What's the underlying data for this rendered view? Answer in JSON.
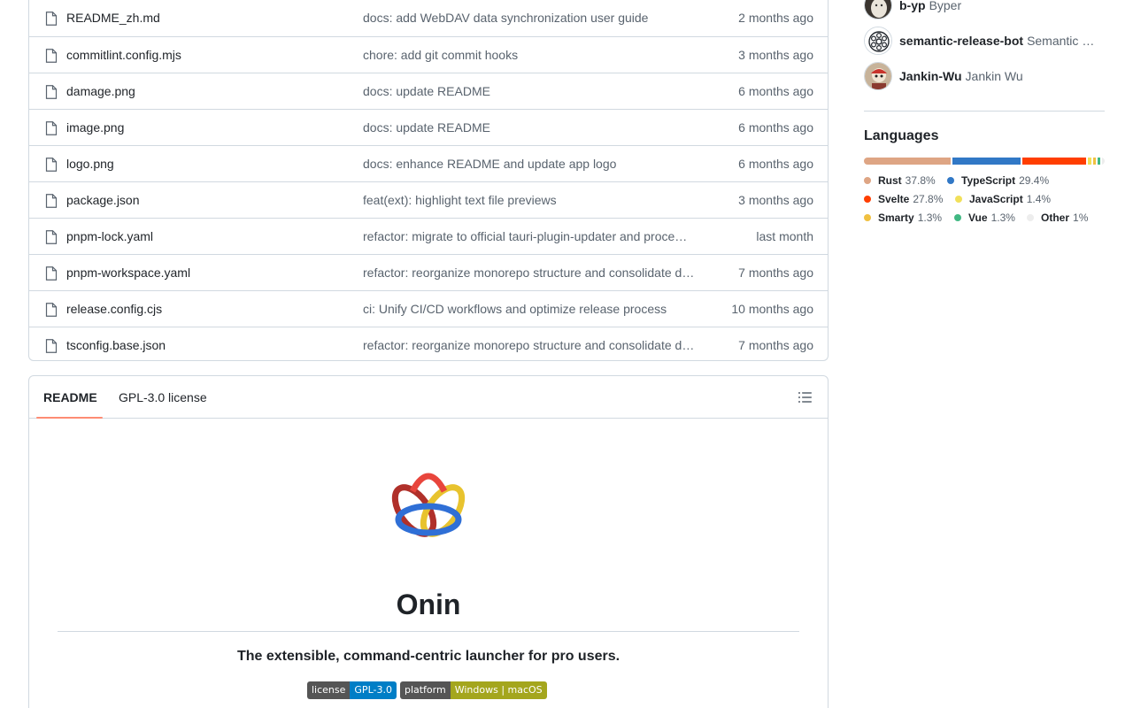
{
  "files": [
    {
      "name": "README_zh.md",
      "message": "docs: add WebDAV data synchronization user guide",
      "date": "2 months ago"
    },
    {
      "name": "commitlint.config.mjs",
      "message": "chore: add git commit hooks",
      "date": "3 months ago"
    },
    {
      "name": "damage.png",
      "message": "docs: update README",
      "date": "6 months ago"
    },
    {
      "name": "image.png",
      "message": "docs: update README",
      "date": "6 months ago"
    },
    {
      "name": "logo.png",
      "message": "docs: enhance README and update app logo",
      "date": "6 months ago"
    },
    {
      "name": "package.json",
      "message": "feat(ext): highlight text file previews",
      "date": "3 months ago"
    },
    {
      "name": "pnpm-lock.yaml",
      "message": "refactor: migrate to official tauri-plugin-updater and proce…",
      "date": "last month"
    },
    {
      "name": "pnpm-workspace.yaml",
      "message": "refactor: reorganize monorepo structure and consolidate d…",
      "date": "7 months ago"
    },
    {
      "name": "release.config.cjs",
      "message": "ci: Unify CI/CD workflows and optimize release process",
      "date": "10 months ago"
    },
    {
      "name": "tsconfig.base.json",
      "message": "refactor: reorganize monorepo structure and consolidate d…",
      "date": "7 months ago"
    }
  ],
  "readme": {
    "tabs": {
      "readme": "README",
      "license": "GPL-3.0 license"
    },
    "title": "Onin",
    "tagline": "The extensible, command-centric launcher for pro users.",
    "badges": {
      "license_label": "license",
      "license_value": "GPL-3.0",
      "platform_label": "platform",
      "platform_value": "Windows | macOS"
    }
  },
  "contributors": [
    {
      "login": "b-yp",
      "name": "Byper"
    },
    {
      "login": "semantic-release-bot",
      "name": "Semantic Release Bot"
    },
    {
      "login": "Jankin-Wu",
      "name": "Jankin Wu"
    }
  ],
  "languages": {
    "title": "Languages",
    "items": [
      {
        "name": "Rust",
        "pct": "37.8%",
        "value": 37.8,
        "color": "#dea584"
      },
      {
        "name": "TypeScript",
        "pct": "29.4%",
        "value": 29.4,
        "color": "#3178c6"
      },
      {
        "name": "Svelte",
        "pct": "27.8%",
        "value": 27.8,
        "color": "#ff3e00"
      },
      {
        "name": "JavaScript",
        "pct": "1.4%",
        "value": 1.4,
        "color": "#f1e05a"
      },
      {
        "name": "Smarty",
        "pct": "1.3%",
        "value": 1.3,
        "color": "#f0c040"
      },
      {
        "name": "Vue",
        "pct": "1.3%",
        "value": 1.3,
        "color": "#41b883"
      },
      {
        "name": "Other",
        "pct": "1%",
        "value": 1.0,
        "color": "#ededed"
      }
    ]
  }
}
